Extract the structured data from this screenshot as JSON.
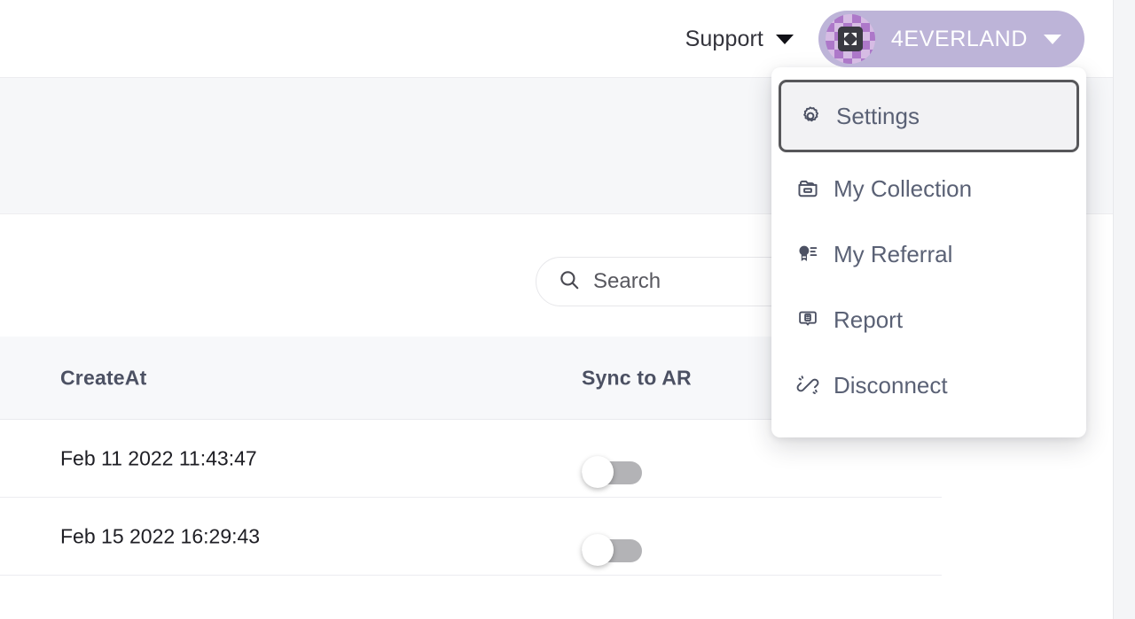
{
  "header": {
    "support": {
      "label": "Support",
      "caret_icon": "chevron-down-icon"
    },
    "account": {
      "name": "4EVERLAND",
      "avatar_icon": "avatar-checker-icon",
      "caret_icon": "chevron-down-icon",
      "pill_color": "#bdb4d8"
    }
  },
  "search": {
    "placeholder": "Search",
    "icon": "search-icon",
    "value": ""
  },
  "account_menu": {
    "items": [
      {
        "label": "Settings",
        "icon": "gear-icon",
        "highlighted": true
      },
      {
        "label": "My Collection",
        "icon": "folder-icon",
        "highlighted": false
      },
      {
        "label": "My Referral",
        "icon": "award-icon",
        "highlighted": false
      },
      {
        "label": "Report",
        "icon": "messages-icon",
        "highlighted": false
      },
      {
        "label": "Disconnect",
        "icon": "broken-link-icon",
        "highlighted": false
      }
    ],
    "highlight_border_color": "#57575a",
    "highlight_background": "#f2f2f4"
  },
  "table": {
    "columns": [
      {
        "key": "createat",
        "label": "CreateAt"
      },
      {
        "key": "sync",
        "label": "Sync to AR"
      }
    ],
    "rows": [
      {
        "createat": "Feb 11 2022 11:43:47",
        "sync_to_ar": "off"
      },
      {
        "createat": "Feb 15 2022 16:29:43",
        "sync_to_ar": "off"
      }
    ]
  }
}
